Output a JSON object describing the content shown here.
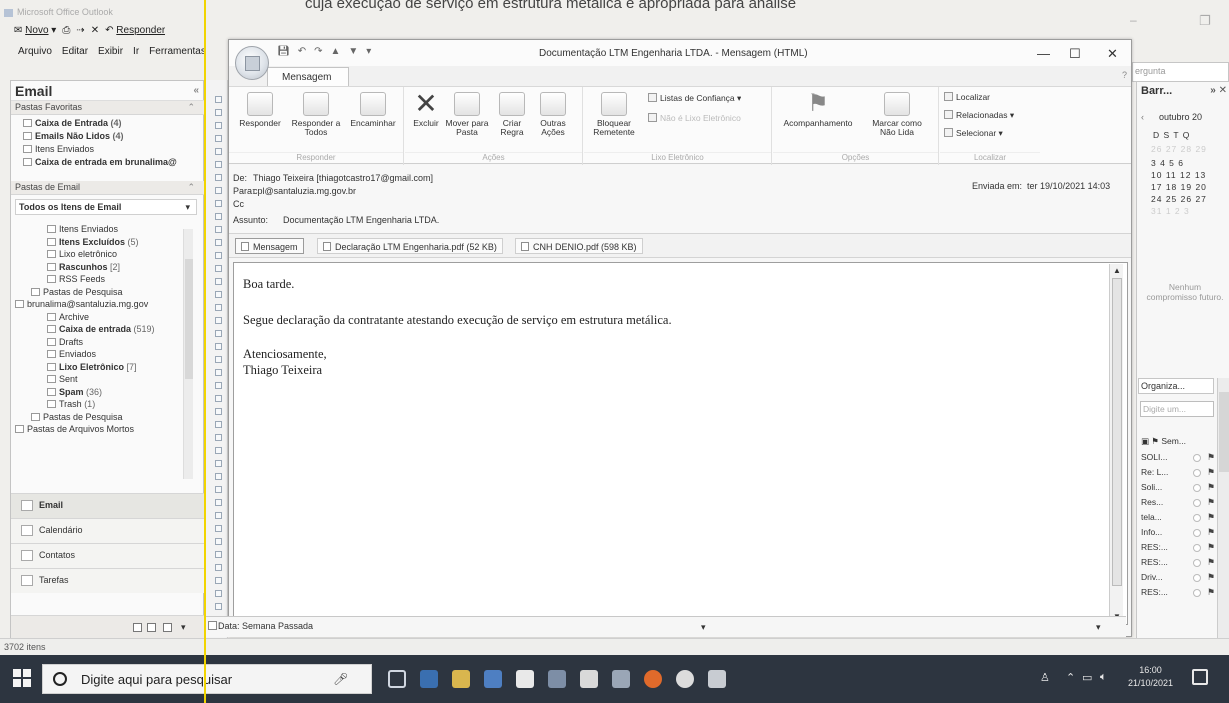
{
  "top_caption": "cuja execução de serviço em estrutura metálica é apropriada para análise",
  "outlook": {
    "title": "Microsoft Office Outlook",
    "toolbar": {
      "new": "Novo",
      "reply": "Responder"
    },
    "menu": [
      "Arquivo",
      "Editar",
      "Exibir",
      "Ir",
      "Ferramentas"
    ],
    "help_placeholder": "ergunta",
    "status": "3702 itens",
    "date_group": "Data: Semana Passada"
  },
  "nav": {
    "title": "Email",
    "favorites_header": "Pastas Favoritas",
    "favorites": [
      {
        "label": "Caixa de Entrada",
        "count": "(4)",
        "bold": true
      },
      {
        "label": "Emails Não Lidos",
        "count": "(4)",
        "bold": true
      },
      {
        "label": "Itens Enviados",
        "count": "",
        "bold": false
      },
      {
        "label": "Caixa de entrada em brunalima@",
        "count": "",
        "bold": true
      }
    ],
    "mail_header": "Pastas de Email",
    "all_items": "Todos os Itens de Email",
    "folders": [
      {
        "label": "Itens Enviados",
        "count": "",
        "bold": false,
        "indent": 2
      },
      {
        "label": "Itens Excluídos",
        "count": "(5)",
        "bold": true,
        "indent": 2
      },
      {
        "label": "Lixo eletrônico",
        "count": "",
        "bold": false,
        "indent": 2
      },
      {
        "label": "Rascunhos",
        "count": "[2]",
        "bold": true,
        "indent": 2
      },
      {
        "label": "RSS Feeds",
        "count": "",
        "bold": false,
        "indent": 2
      },
      {
        "label": "Pastas de Pesquisa",
        "count": "",
        "bold": false,
        "indent": 1
      },
      {
        "label": "brunalima@santaluzia.mg.gov",
        "count": "",
        "bold": false,
        "indent": 0
      },
      {
        "label": "Archive",
        "count": "",
        "bold": false,
        "indent": 2
      },
      {
        "label": "Caixa de entrada",
        "count": "(519)",
        "bold": true,
        "indent": 2
      },
      {
        "label": "Drafts",
        "count": "",
        "bold": false,
        "indent": 2
      },
      {
        "label": "Enviados",
        "count": "",
        "bold": false,
        "indent": 2
      },
      {
        "label": "Lixo Eletrônico",
        "count": "[7]",
        "bold": true,
        "indent": 2
      },
      {
        "label": "Sent",
        "count": "",
        "bold": false,
        "indent": 2
      },
      {
        "label": "Spam",
        "count": "(36)",
        "bold": true,
        "indent": 2
      },
      {
        "label": "Trash",
        "count": "(1)",
        "bold": false,
        "indent": 2
      },
      {
        "label": "Pastas de Pesquisa",
        "count": "",
        "bold": false,
        "indent": 1
      },
      {
        "label": "Pastas de Arquivos Mortos",
        "count": "",
        "bold": false,
        "indent": 0
      }
    ],
    "buttons": [
      "Email",
      "Calendário",
      "Contatos",
      "Tarefas"
    ]
  },
  "message": {
    "window_title": "Documentação LTM Engenharia LTDA. - Mensagem (HTML)",
    "tab": "Mensagem",
    "ribbon": {
      "responder_group": "Responder",
      "reply": "Responder",
      "reply_all": "Responder a Todos",
      "forward": "Encaminhar",
      "acoes_group": "Ações",
      "delete": "Excluir",
      "move": "Mover para Pasta",
      "create_rule": "Criar Regra",
      "other_actions": "Outras Ações",
      "lixo_group": "Lixo Eletrônico",
      "block": "Bloquear Remetente",
      "safe_lists": "Listas de Confiança",
      "not_junk": "Não é Lixo Eletrônico",
      "opcoes_group": "Opções",
      "followup": "Acompanhamento",
      "mark_unread": "Marcar como Não Lida",
      "localizar_group": "Localizar",
      "find": "Localizar",
      "related": "Relacionadas",
      "select": "Selecionar"
    },
    "labels": {
      "from": "De:",
      "to": "Para:",
      "cc": "Cc",
      "subject": "Assunto:",
      "sent": "Enviada em:"
    },
    "from": "Thiago Teixeira [thiagotcastro17@gmail.com]",
    "to": "cpl@santaluzia.mg.gov.br",
    "cc": "",
    "subject": "Documentação LTM Engenharia LTDA.",
    "sent": "ter 19/10/2021 14:03",
    "attachments": [
      {
        "label": "Mensagem"
      },
      {
        "label": "Declaração LTM Engenharia.pdf (52 KB)"
      },
      {
        "label": "CNH DENIO.pdf (598 KB)"
      }
    ],
    "body": {
      "greeting": "Boa tarde.",
      "line1": "Segue declaração da contratante atestando execução de serviço em estrutura metálica.",
      "closing": "Atenciosamente,",
      "signature": "Thiago Teixeira"
    }
  },
  "todo": {
    "title": "Barr...",
    "month": "outubro 20",
    "weekdays": "D  S  T  Q",
    "weeks": [
      "26 27 28 29",
      "3  4  5  6",
      "10 11 12 13",
      "17 18 19 20",
      "24 25 26 27",
      "31  1  2  3"
    ],
    "no_appointments": "Nenhum compromisso futuro.",
    "arrange": "Organiza...",
    "input_placeholder": "Digite um...",
    "sort": "Sem...",
    "tasks": [
      "SOLI...",
      "Re: L...",
      "Soli...",
      "Res...",
      "tela...",
      "Info...",
      "RES:...",
      "RES:...",
      "Driv...",
      "RES:..."
    ]
  },
  "taskbar": {
    "search": "Digite aqui para pesquisar",
    "time": "16:00",
    "date": "21/10/2021"
  }
}
